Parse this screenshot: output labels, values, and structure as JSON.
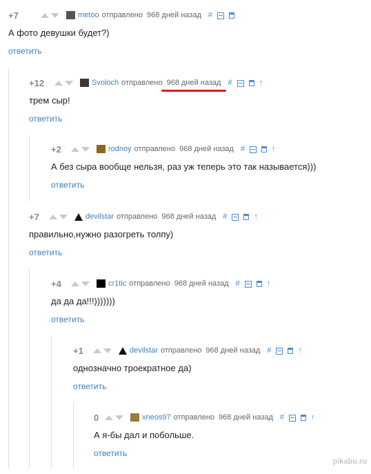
{
  "comments": [
    {
      "score": "+7",
      "user": "metoo",
      "meta": "отправлено",
      "date": "968 дней назад",
      "text": "А фото девушки будет?)",
      "reply": "ответить",
      "avatar": "metoo-avatar",
      "avatar_color": "#555555",
      "has_parent_link": false,
      "highlight_date": false
    },
    {
      "score": "+12",
      "user": "Svoloch",
      "meta": "отправлено",
      "date": "968 дней назад",
      "text": "трем сыр!",
      "reply": "ответить",
      "avatar": "svoloch-avatar",
      "avatar_color": "#3a3a3a",
      "has_parent_link": true,
      "highlight_date": true
    },
    {
      "score": "+2",
      "user": "rodnoy",
      "meta": "отправлено",
      "date": "968 дней назад",
      "text": "А без сыра вообще нельзя, раз уж теперь это так называется)))",
      "reply": "ответить",
      "avatar": "rodnoy-avatar",
      "avatar_color": "#8a6a1a",
      "has_parent_link": true,
      "highlight_date": false
    },
    {
      "score": "+7",
      "user": "devilstar",
      "meta": "отправлено",
      "date": "968 дней назад",
      "text": "правильно,нужно разогреть толпу)",
      "reply": "ответить",
      "avatar": "devilstar-avatar",
      "avatar_color": "#111111",
      "has_parent_link": true,
      "highlight_date": false
    },
    {
      "score": "+4",
      "user": "cr1tic",
      "meta": "отправлено",
      "date": "968 дней назад",
      "text": "да да да!!!)))))))",
      "reply": "ответить",
      "avatar": "cr1tic-avatar",
      "avatar_color": "#000000",
      "has_parent_link": true,
      "highlight_date": false
    },
    {
      "score": "+1",
      "user": "devilstar",
      "meta": "отправлено",
      "date": "968 дней назад",
      "text": "однозначно троекратное да)",
      "reply": "ответить",
      "avatar": "devilstar-avatar",
      "avatar_color": "#111111",
      "has_parent_link": true,
      "highlight_date": false
    },
    {
      "score": "0",
      "user": "xneos97",
      "meta": "отправлено",
      "date": "968 дней назад",
      "text": "А я-бы дал и побольше.",
      "reply": "ответить",
      "avatar": "xneos97-avatar",
      "avatar_color": "#9a7a40",
      "has_parent_link": true,
      "highlight_date": false
    }
  ],
  "icons": {
    "anchor": "#",
    "collapse": "collapse-icon",
    "save": "save-icon",
    "parent": "↑"
  },
  "colors": {
    "link": "#3d80bd",
    "icon": "#4a8ad0",
    "score": "#888888",
    "underline": "#e01818"
  },
  "watermark": "pikabu.ru"
}
